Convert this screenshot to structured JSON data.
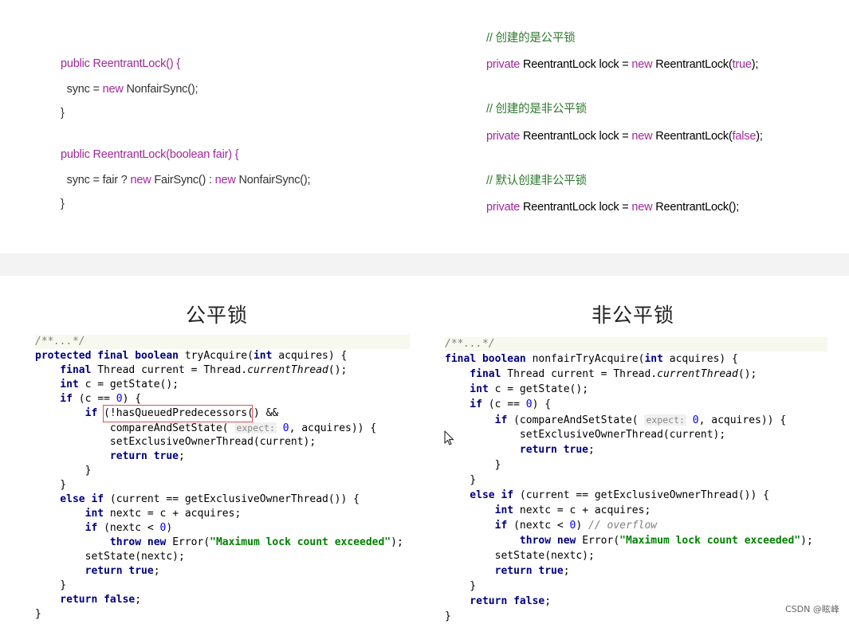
{
  "top_left": {
    "ctor1": {
      "l1_a": "public ",
      "l1_b": "ReentrantLock() {",
      "l2_a": "  sync = ",
      "l2_b": "new ",
      "l2_c": "NonfairSync();",
      "l3": "}"
    },
    "ctor2": {
      "l1_a": "public ",
      "l1_b": "ReentrantLock(boolean fair) {",
      "l2_a": "  sync = fair ? ",
      "l2_b": "new ",
      "l2_c": "FairSync() : ",
      "l2_d": "new ",
      "l2_e": "NonfairSync();",
      "l3": "}"
    }
  },
  "top_right": {
    "c1": "// 创建的是公平锁",
    "u1_a": "private ",
    "u1_b": "ReentrantLock lock = ",
    "u1_c": "new ",
    "u1_d": "ReentrantLock(",
    "u1_e": "true",
    "u1_f": ");",
    "c2": "// 创建的是非公平锁",
    "u2_a": "private ",
    "u2_b": "ReentrantLock lock = ",
    "u2_c": "new ",
    "u2_d": "ReentrantLock(",
    "u2_e": "false",
    "u2_f": ");",
    "c3": "// 默认创建非公平锁",
    "u3_a": "private ",
    "u3_b": "ReentrantLock lock = ",
    "u3_c": "new ",
    "u3_d": "ReentrantLock();"
  },
  "titles": {
    "fair": "公平锁",
    "nonfair": "非公平锁"
  },
  "fair_code": {
    "comment": "/**...*/",
    "l1_k": "protected final boolean ",
    "l1_b": "tryAcquire(",
    "l1_k2": "int ",
    "l1_c": "acquires) {",
    "l2_k": "    final ",
    "l2_b": "Thread current = Thread.",
    "l2_i": "currentThread",
    "l2_c": "();",
    "l3_k": "    int ",
    "l3_b": "c = getState();",
    "l4_k": "    if ",
    "l4_b": "(c == ",
    "l4_n": "0",
    "l4_c": ") {",
    "l5_k": "        if ",
    "l5_b": "(!hasQueuedPredecessors() &&",
    "l6_a": "            compareAndSetState( ",
    "l6_h": "expect:",
    "l6_n": " 0",
    "l6_b": ", acquires)) {",
    "l7": "            setExclusiveOwnerThread(current);",
    "l8_k": "            return true",
    "l8_b": ";",
    "l9": "        }",
    "l10": "    }",
    "l11_k": "    else if ",
    "l11_b": "(current == getExclusiveOwnerThread()) {",
    "l12_k": "        int ",
    "l12_b": "nextc = c + acquires;",
    "l13_k": "        if ",
    "l13_b": "(nextc < ",
    "l13_n": "0",
    "l13_c": ")",
    "l14_k": "            throw new ",
    "l14_b": "Error(",
    "l14_s": "\"Maximum lock count exceeded\"",
    "l14_c": ");",
    "l15": "        setState(nextc);",
    "l16_k": "        return true",
    "l16_b": ";",
    "l17": "    }",
    "l18_k": "    return false",
    "l18_b": ";",
    "l19": "}"
  },
  "nonfair_code": {
    "comment": "/**...*/",
    "l1_k": "final boolean ",
    "l1_b": "nonfairTryAcquire(",
    "l1_k2": "int ",
    "l1_c": "acquires) {",
    "l2_k": "    final ",
    "l2_b": "Thread current = Thread.",
    "l2_i": "currentThread",
    "l2_c": "();",
    "l3_k": "    int ",
    "l3_b": "c = getState();",
    "l4_k": "    if ",
    "l4_b": "(c == ",
    "l4_n": "0",
    "l4_c": ") {",
    "l5_k": "        if ",
    "l5_b": "(compareAndSetState( ",
    "l5_h": "expect:",
    "l5_n": " 0",
    "l5_c": ", acquires)) {",
    "l6": "            setExclusiveOwnerThread(current);",
    "l7_k": "            return true",
    "l7_b": ";",
    "l8": "        }",
    "l9": "    }",
    "l10_k": "    else if ",
    "l10_b": "(current == getExclusiveOwnerThread()) {",
    "l11_k": "        int ",
    "l11_b": "nextc = c + acquires;",
    "l12_k": "        if ",
    "l12_b": "(nextc < ",
    "l12_n": "0",
    "l12_c": ") ",
    "l12_cm": "// overflow",
    "l13_k": "            throw new ",
    "l13_b": "Error(",
    "l13_s": "\"Maximum lock count exceeded\"",
    "l13_c": ");",
    "l14": "        setState(nextc);",
    "l15_k": "        return true",
    "l15_b": ";",
    "l16": "    }",
    "l17_k": "    return false",
    "l17_b": ";",
    "l18": "}"
  },
  "watermark": "CSDN @眩峰",
  "colors": {
    "keyword_purple": "#a0289a",
    "comment_green": "#2d7a2d",
    "java_keyword": "#000080",
    "java_string": "#008000",
    "java_number": "#0000ff",
    "highlight_red": "#d9534f"
  }
}
